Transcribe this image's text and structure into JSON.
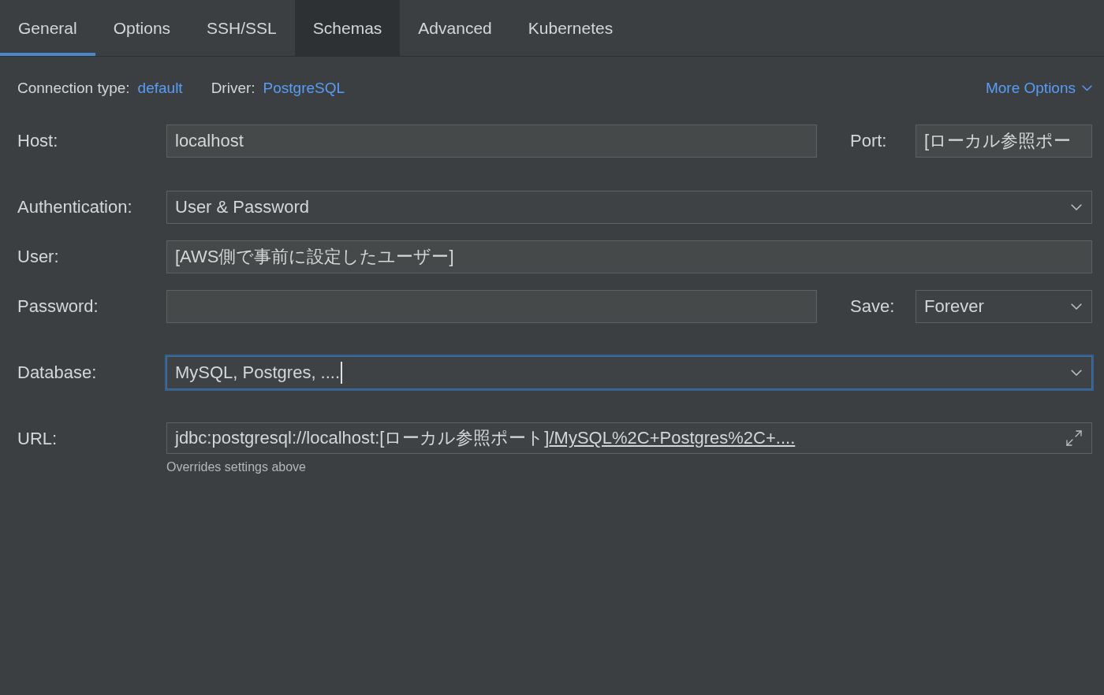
{
  "tabs": [
    {
      "label": "General",
      "selected": true,
      "hovered": false
    },
    {
      "label": "Options",
      "selected": false,
      "hovered": false
    },
    {
      "label": "SSH/SSL",
      "selected": false,
      "hovered": false
    },
    {
      "label": "Schemas",
      "selected": false,
      "hovered": true
    },
    {
      "label": "Advanced",
      "selected": false,
      "hovered": false
    },
    {
      "label": "Kubernetes",
      "selected": false,
      "hovered": false
    }
  ],
  "connection": {
    "type_label": "Connection type:",
    "type_value": "default",
    "driver_label": "Driver:",
    "driver_value": "PostgreSQL",
    "more_options": "More Options"
  },
  "groups": [
    [
      {
        "kind": "text",
        "label": "Host:",
        "value": "localhost",
        "focused": false,
        "side": {
          "kind": "text",
          "label": "Port:",
          "value": "[ローカル参照ポー"
        }
      }
    ],
    [
      {
        "kind": "select",
        "label": "Authentication:",
        "value": "User & Password",
        "focused": false
      },
      {
        "kind": "text",
        "label": "User:",
        "value": "[AWS側で事前に設定したユーザー]",
        "focused": false
      },
      {
        "kind": "password",
        "label": "Password:",
        "focused": false,
        "side": {
          "kind": "select",
          "label": "Save:",
          "value": "Forever"
        }
      }
    ],
    [
      {
        "kind": "select",
        "label": "Database:",
        "value": "MySQL, Postgres, ....",
        "focused": true
      }
    ],
    [
      {
        "kind": "url",
        "label": "URL:",
        "value": "jdbc:postgresql://localhost:[ローカル参照ポート]",
        "link": "/MySQL%2C+Postgres%2C+....",
        "note": "Overrides settings above",
        "focused": false
      }
    ]
  ]
}
